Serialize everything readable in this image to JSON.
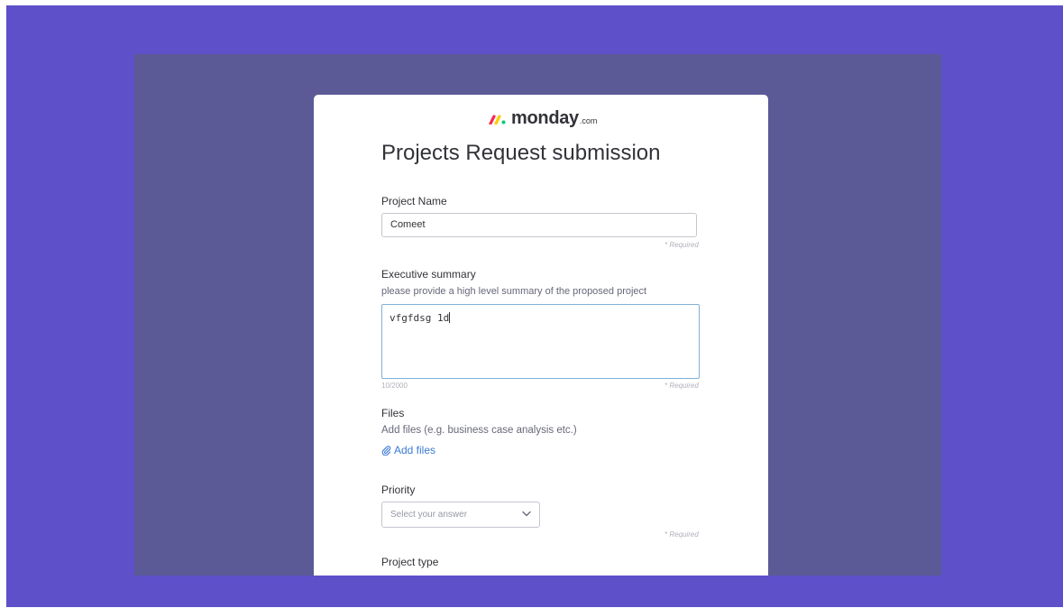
{
  "logo": {
    "word": "monday",
    "suffix": ".com"
  },
  "form": {
    "title": "Projects Request submission",
    "required_label": "* Required",
    "project_name": {
      "label": "Project Name",
      "value": "Comeet"
    },
    "executive_summary": {
      "label": "Executive summary",
      "description": "please provide a high level summary of the proposed project",
      "value": "vfgfdsg 1d",
      "counter": "10/2000"
    },
    "files": {
      "label": "Files",
      "description": "Add files (e.g. business case analysis etc.)",
      "add_label": "Add files"
    },
    "priority": {
      "label": "Priority",
      "placeholder": "Select your answer"
    },
    "project_type": {
      "label": "Project type"
    }
  },
  "colors": {
    "outer_background": "#5d50c9",
    "backdrop": "#5b5a96",
    "card": "#ffffff",
    "link": "#3a7bd5",
    "logo_red": "#f62b54",
    "logo_yellow": "#ffcc00",
    "logo_green": "#00ca72"
  },
  "icons": {
    "logo": "monday-logo-icon",
    "attachment": "paperclip-icon",
    "dropdown": "chevron-down-icon"
  }
}
